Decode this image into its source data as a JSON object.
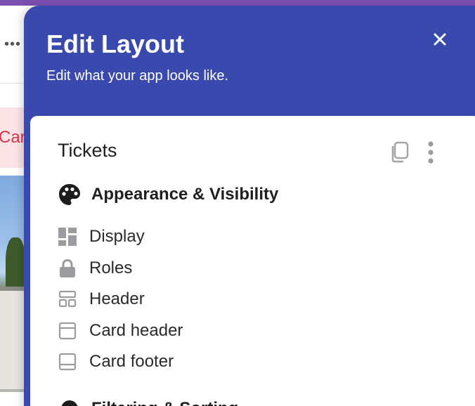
{
  "background": {
    "partial_label": "Car"
  },
  "panel": {
    "title": "Edit Layout",
    "subtitle": "Edit what your app looks like.",
    "accent_color": "#3a49ad"
  },
  "card": {
    "title": "Tickets",
    "sections": [
      {
        "heading": "Appearance & Visibility",
        "icon": "palette-icon",
        "items": [
          {
            "label": "Display",
            "icon": "dashboard-icon"
          },
          {
            "label": "Roles",
            "icon": "lock-icon"
          },
          {
            "label": "Header",
            "icon": "header-layout-icon"
          },
          {
            "label": "Card header",
            "icon": "card-header-icon"
          },
          {
            "label": "Card footer",
            "icon": "card-footer-icon"
          }
        ]
      },
      {
        "heading": "Filtering & Sorting",
        "icon": "filter-icon"
      }
    ]
  }
}
